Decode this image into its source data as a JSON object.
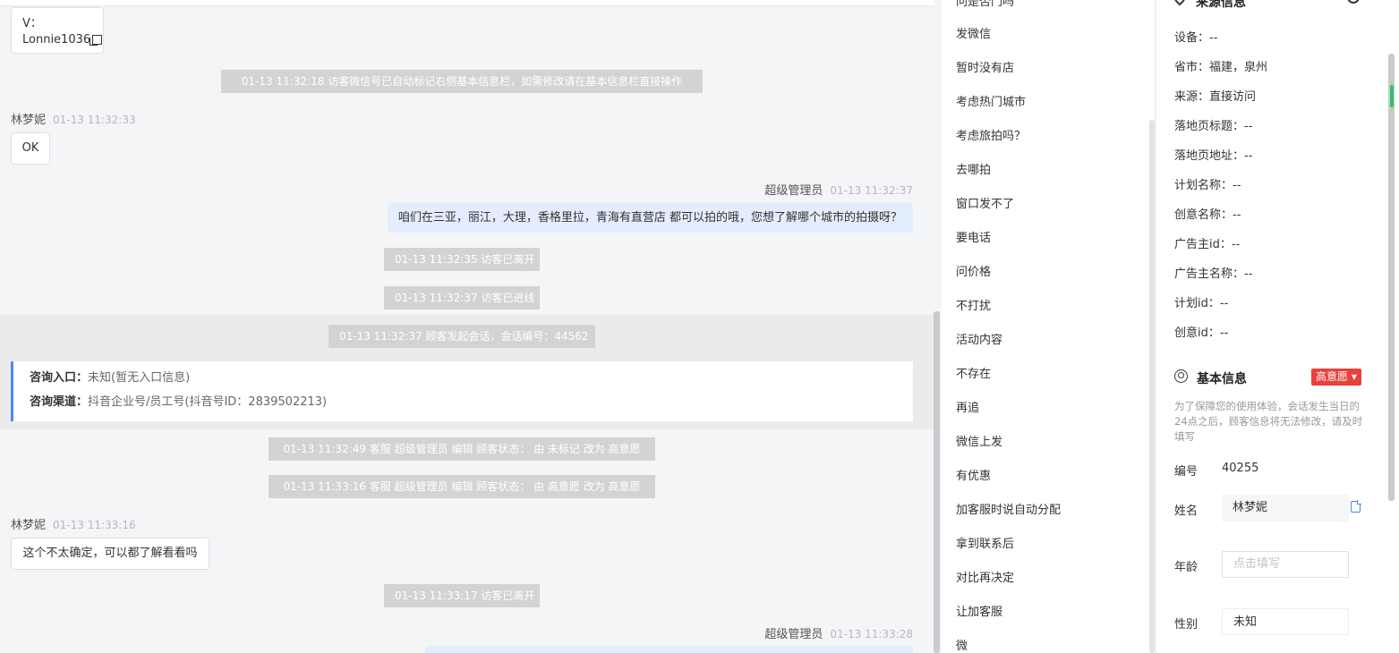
{
  "chat": {
    "wechat_card": {
      "line1": "V：",
      "line2": "Lonnie1036"
    },
    "messages": [
      {
        "kind": "system",
        "text": "01-13 11:32:18 访客微信号已自动标记右侧基本信息栏，如需修改请在基本信息栏直接操作"
      },
      {
        "kind": "visitor",
        "name": "林梦妮",
        "time": "01-13 11:32:33",
        "text": "OK"
      },
      {
        "kind": "agent",
        "name": "超级管理员",
        "time": "01-13 11:32:37",
        "text": "咱们在三亚，丽江，大理，香格里拉，青海有直营店 都可以拍的哦，您想了解哪个城市的拍摄呀？"
      },
      {
        "kind": "system",
        "text": "01-13 11:32:35 访客已离开"
      },
      {
        "kind": "system",
        "text": "01-13 11:32:37 访客已进线"
      },
      {
        "kind": "system",
        "text": "01-13 11:32:37 顾客发起会话，会话编号：44562"
      },
      {
        "kind": "system",
        "text": "01-13 11:32:49 客服 超级管理员 编辑 顾客状态： 由 未标记 改为 高意愿"
      },
      {
        "kind": "system",
        "text": "01-13 11:33:16 客服 超级管理员 编辑 顾客状态： 由 高意愿 改为 高意愿"
      },
      {
        "kind": "visitor",
        "name": "林梦妮",
        "time": "01-13 11:33:16",
        "text": "这个不太确定，可以都了解看看吗"
      },
      {
        "kind": "system",
        "text": "01-13 11:33:17 访客已离开"
      },
      {
        "kind": "agent",
        "name": "超级管理员",
        "time": "01-13 11:33:28",
        "text": ""
      }
    ],
    "consult_card": {
      "entry_label": "咨询入口：",
      "entry_value": "未知(暂无入口信息)",
      "channel_label": "咨询渠道：",
      "channel_value": "抖音企业号/员工号(抖音号ID：2839502213)"
    }
  },
  "quick_replies": {
    "items": [
      "问是否门吗",
      "发微信",
      "暂时没有店",
      "考虑热门城市",
      "考虑旅拍吗？",
      "去哪拍",
      "窗口发不了",
      "要电话",
      "问价格",
      "不打扰",
      "活动内容",
      "不存在",
      "再追",
      "微信上发",
      "有优惠",
      "加客服时说自动分配",
      "拿到联系后",
      "对比再决定",
      "让加客服",
      "微"
    ]
  },
  "info_panel": {
    "source_title": "来源信息",
    "source_fields": [
      {
        "label": "设备：",
        "value": "--"
      },
      {
        "label": "省市：",
        "value": "福建，泉州"
      },
      {
        "label": "来源：",
        "value": "直接访问"
      },
      {
        "label": "落地页标题：",
        "value": "--"
      },
      {
        "label": "落地页地址：",
        "value": "--"
      },
      {
        "label": "计划名称：",
        "value": "--"
      },
      {
        "label": "创意名称：",
        "value": "--"
      },
      {
        "label": "广告主id：",
        "value": "--"
      },
      {
        "label": "广告主名称：",
        "value": "--"
      },
      {
        "label": "计划id：",
        "value": "--"
      },
      {
        "label": "创意id：",
        "value": "--"
      }
    ],
    "basic_title": "基本信息",
    "intent_badge": "高意愿 ▾",
    "notice": "为了保障您的使用体验，会话发生当日的24点之后，顾客信息将无法修改，请及时填写",
    "number_label": "编号",
    "number_value": "40255",
    "name_label": "姓名",
    "name_value": "林梦妮",
    "age_label": "年龄",
    "age_placeholder": "点击填写",
    "gender_label": "性别",
    "gender_value": "未知"
  },
  "colors": {
    "accent": "#4a8bf5",
    "badge": "#e8413c",
    "agent_bubble": "#e3edfd",
    "system_bg": "#d2d3d5"
  }
}
